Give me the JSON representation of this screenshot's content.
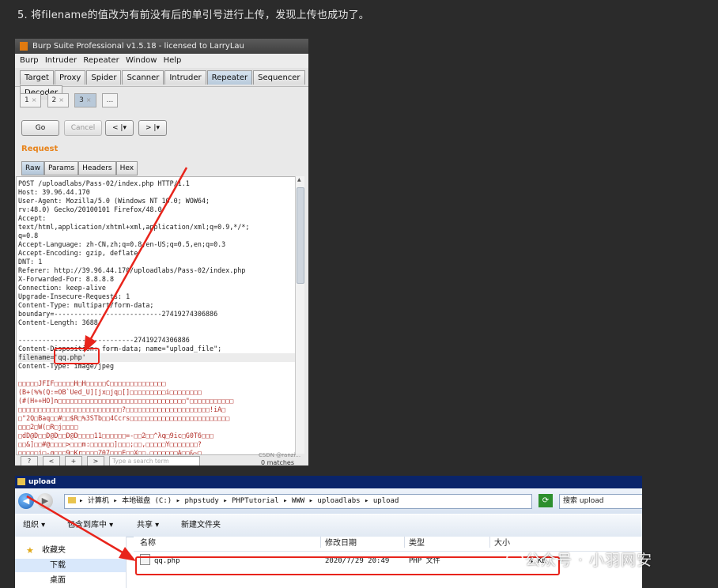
{
  "heading": "5. 将filename的值改为有前没有后的单引号进行上传，发现上传也成功了。",
  "burp": {
    "title": "Burp Suite Professional v1.5.18 - licensed to LarryLau",
    "menu": [
      "Burp",
      "Intruder",
      "Repeater",
      "Window",
      "Help"
    ],
    "tabs": [
      "Target",
      "Proxy",
      "Spider",
      "Scanner",
      "Intruder",
      "Repeater",
      "Sequencer",
      "Decoder"
    ],
    "active_tab": "Repeater",
    "subtabs": [
      {
        "label": "1",
        "close": "×"
      },
      {
        "label": "2",
        "close": "×"
      },
      {
        "label": "3",
        "close": "×"
      },
      {
        "label": "...",
        "close": ""
      }
    ],
    "buttons": {
      "go": "Go",
      "cancel": "Cancel",
      "back": "< |▾",
      "forward": "> |▾"
    },
    "request_label": "Request",
    "request_tabs": [
      "Raw",
      "Params",
      "Headers",
      "Hex"
    ],
    "request_lines": [
      "POST /uploadlabs/Pass-02/index.php HTTP/1.1",
      "Host: 39.96.44.170",
      "User-Agent: Mozilla/5.0 (Windows NT 10.0; WOW64;",
      "rv:48.0) Gecko/20100101 Firefox/48.0",
      "Accept:",
      "text/html,application/xhtml+xml,application/xml;q=0.9,*/*;",
      "q=0.8",
      "Accept-Language: zh-CN,zh;q=0.8,en-US;q=0.5,en;q=0.3",
      "Accept-Encoding: gzip, deflate",
      "DNT: 1",
      "Referer: http://39.96.44.170/uploadlabs/Pass-02/index.php",
      "X-Forwarded-For: 8.8.8.8",
      "Connection: keep-alive",
      "Upgrade-Insecure-Requests: 1",
      "Content-Type: multipart/form-data;",
      "boundary=---------------------------27419274306886",
      "Content-Length: 3688",
      "",
      "-----------------------------27419274306886",
      "Content-Disposition: form-data; name=\"upload_file\";",
      "filename='qq.php'",
      "Content-Type: image/jpeg"
    ],
    "binary_lines": [
      "□□□□□JFIF□□□□□H□H□□□□□C□□□□□□□□□□□□□□",
      "(B+(%%(Q:=OB`Ued_U][jx□jq□[]□□□□□□□□□i□□□□□□□□",
      "(#(H++HO]n□□□□□□□□□□□□□□□□□□□□□□□□□□□□□□□□\"□□□□□□□□□□□",
      "□□□□□□□□□□□□□□□□□□□□□□□□□□?□□□□□□□□□□□□□□□□□□□□□!iA□",
      "□\"2Q□Baq□□#□□$R□%3STb□□4Ccrs□□□□□□□□□□□□□□□□□□□□□□□□□",
      "□□□2□W(□R□j□□□□",
      "□dD@D□□D@D□□D@D□□□□11□□□□□□=-□□2□□^λq□9ic□G0T6□□□",
      "□□&]□□#@□□□□>□□□m:□□□□□□]□□□;□□,□□□□□Y□□□□□□□?",
      "□□□□□j□-q□□□9□Kr□□□□Z07□□□E□□X□□.□□□□□□□A□□&~□"
    ],
    "search_placeholder": "Type a search term",
    "search_buttons": [
      "?",
      "<",
      "+",
      ">"
    ],
    "matches": "0 matches",
    "watermark": "CSDN @ranzi..."
  },
  "explorer": {
    "title": "upload",
    "address": "▸ 计算机 ▸ 本地磁盘 (C:) ▸ phpstudy ▸ PHPTutorial ▸ WWW ▸ uploadlabs ▸ upload",
    "search_label": "搜索 upload",
    "toolbar": {
      "organize": "组织 ▾",
      "include": "包含到库中 ▾",
      "share": "共享 ▾",
      "new_folder": "新建文件夹"
    },
    "nav": {
      "favorites": "收藏夹",
      "downloads": "下载",
      "desktop": "桌面"
    },
    "columns": {
      "name": "名称",
      "date": "修改日期",
      "type": "类型",
      "size": "大小"
    },
    "file": {
      "name": "qq.php",
      "date": "2020/7/29 20:49",
      "type": "PHP 文件",
      "size": "4 KB"
    }
  },
  "watermark_text": "公众号 · 小羽网安",
  "colors": {
    "highlight_red": "#e8241b",
    "request_orange": "#e8831a",
    "titlebar_blue": "#0a246a"
  }
}
